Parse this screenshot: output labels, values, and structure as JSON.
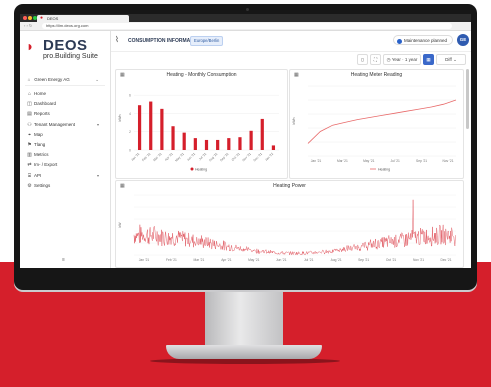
{
  "browser": {
    "tab_title": "DEOS",
    "url": "https://lim.deos.org.com"
  },
  "sidebar": {
    "brand": "DEOS",
    "suite": "pro.Building Suite",
    "company": "Green Energy AG",
    "items": [
      {
        "icon": "home-icon",
        "glyph": "⌂",
        "label": "Home",
        "has_chevron": false
      },
      {
        "icon": "dashboard-icon",
        "glyph": "◫",
        "label": "Dashboard",
        "has_chevron": false
      },
      {
        "icon": "reports-icon",
        "glyph": "▤",
        "label": "Reports",
        "has_chevron": false
      },
      {
        "icon": "tenant-icon",
        "glyph": "⚇",
        "label": "Tenant Management",
        "has_chevron": true
      },
      {
        "icon": "map-icon",
        "glyph": "⌖",
        "label": "Map",
        "has_chevron": false
      },
      {
        "icon": "tags-icon",
        "glyph": "⚑",
        "label": "Tlang",
        "has_chevron": false
      },
      {
        "icon": "metrics-icon",
        "glyph": "▥",
        "label": "Metrics",
        "has_chevron": false
      },
      {
        "icon": "import-export-icon",
        "glyph": "⇄",
        "label": "Im- / Export",
        "has_chevron": false
      },
      {
        "icon": "api-icon",
        "glyph": "⌸",
        "label": "API",
        "has_chevron": true
      },
      {
        "icon": "settings-icon",
        "glyph": "⚙",
        "label": "Settings",
        "has_chevron": false
      }
    ],
    "collapse_glyph": "≡"
  },
  "header": {
    "title": "CONSUMPTION INFORMATION",
    "badge": "Europe/Berlin",
    "maintenance": "Maintenance planned",
    "avatar": "GE"
  },
  "toolbar": {
    "range": "Year · 1 year",
    "mode": "Diff"
  },
  "colors": {
    "brand_red": "#d51f2b",
    "navy": "#2d3b55",
    "accent_blue": "#3a68c9"
  },
  "cards": {
    "monthly": {
      "title": "Heating - Monthly Consumption",
      "legend": "Heating",
      "ylabel": "kWh"
    },
    "meter": {
      "title": "Heating Meter Reading",
      "legend": "Heating",
      "ylabel": "kWh"
    },
    "power": {
      "title": "Heating Power",
      "ylabel": "kW"
    }
  },
  "chart_data": [
    {
      "type": "bar",
      "title": "Heating - Monthly Consumption",
      "categories": [
        "Jan '21",
        "Feb '21",
        "Mar '21",
        "Apr '21",
        "May '21",
        "Jun '21",
        "Jul '21",
        "Aug '21",
        "Sep '21",
        "Oct '21",
        "Nov '21",
        "Dec '21",
        "Jan '22"
      ],
      "series": [
        {
          "name": "Heating",
          "values": [
            4.9,
            5.3,
            4.5,
            2.6,
            1.9,
            1.3,
            1.1,
            1.1,
            1.3,
            1.4,
            2.1,
            3.4,
            0.5
          ]
        }
      ],
      "ylim": [
        0,
        7
      ]
    },
    {
      "type": "line",
      "title": "Heating Meter Reading",
      "x": [
        "Jan '21",
        "Mar '21",
        "May '21",
        "Jul '21",
        "Sep '21",
        "Nov '21"
      ],
      "series": [
        {
          "name": "Heating",
          "values": [
            18,
            35,
            44,
            48,
            52,
            55,
            58,
            61,
            64,
            67,
            70,
            74,
            80
          ]
        }
      ],
      "ylim": [
        0,
        100
      ]
    },
    {
      "type": "line",
      "title": "Heating Power",
      "x": [
        "Jan '21",
        "Feb '21",
        "Mar '21",
        "Apr '21",
        "May '21",
        "Jun '21",
        "Jul '21",
        "Aug '21",
        "Sep '21",
        "Oct '21",
        "Nov '21",
        "Dec '21"
      ],
      "series": [
        {
          "values": "dense noisy signal"
        }
      ],
      "ylim": [
        0,
        5
      ]
    }
  ]
}
